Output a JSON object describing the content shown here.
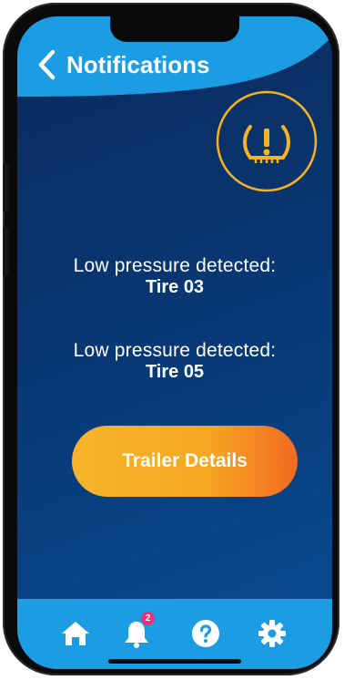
{
  "header": {
    "title": "Notifications",
    "back_icon": "chevron-left-icon",
    "background_color": "#1b9ce3"
  },
  "alert": {
    "icon": "tire-pressure-warning-icon",
    "accent_color": "#f5b324"
  },
  "notifications": [
    {
      "message": "Low pressure detected:",
      "tire": "Tire 03"
    },
    {
      "message": "Low pressure detected:",
      "tire": "Tire 05"
    }
  ],
  "action": {
    "label": "Trailer Details",
    "gradient_start": "#f6b52c",
    "gradient_end": "#f26b21"
  },
  "bottom_nav": {
    "background_color": "#1b9ce3",
    "items": [
      {
        "icon": "home-icon"
      },
      {
        "icon": "bell-icon",
        "badge": "2"
      },
      {
        "icon": "help-icon"
      },
      {
        "icon": "gear-icon"
      }
    ]
  },
  "screen_background": [
    "#0b2a5c",
    "#0a4e92"
  ]
}
